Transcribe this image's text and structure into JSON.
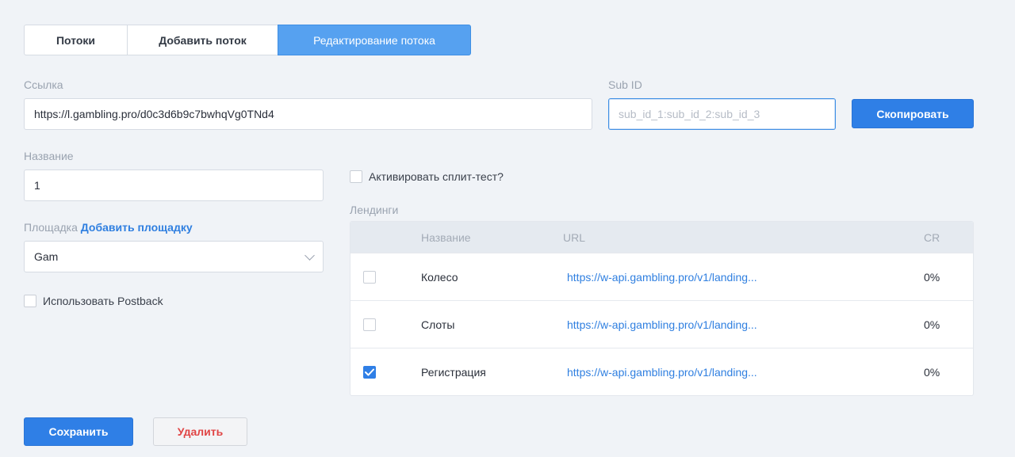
{
  "tabs": [
    {
      "label": "Потоки"
    },
    {
      "label": "Добавить поток"
    },
    {
      "label": "Редактирование потока",
      "active": true
    }
  ],
  "link": {
    "label": "Ссылка",
    "value": "https://l.gambling.pro/d0c3d6b9c7bwhqVg0TNd4"
  },
  "subid": {
    "label": "Sub ID",
    "placeholder": "sub_id_1:sub_id_2:sub_id_3",
    "value": ""
  },
  "copy_button": {
    "label": "Скопировать"
  },
  "name": {
    "label": "Название",
    "value": "1"
  },
  "platform": {
    "label": "Площадка",
    "add_link": "Добавить площадку",
    "selected": "Gam"
  },
  "postback": {
    "label": "Использовать Postback",
    "checked": false
  },
  "split_test": {
    "label": "Активировать сплит-тест?",
    "checked": false
  },
  "landings": {
    "label": "Лендинги",
    "columns": {
      "name": "Название",
      "url": "URL",
      "cr": "CR"
    },
    "rows": [
      {
        "name": "Колесо",
        "url": "https://w-api.gambling.pro/v1/landing...",
        "cr": "0%",
        "checked": false
      },
      {
        "name": "Слоты",
        "url": "https://w-api.gambling.pro/v1/landing...",
        "cr": "0%",
        "checked": false
      },
      {
        "name": "Регистрация",
        "url": "https://w-api.gambling.pro/v1/landing...",
        "cr": "0%",
        "checked": true
      }
    ]
  },
  "actions": {
    "save": "Сохранить",
    "delete": "Удалить"
  },
  "colors": {
    "accent": "#2f7fe6",
    "tab_active": "#56a1f0",
    "danger": "#e04545",
    "background": "#f0f3f7"
  },
  "icons": {
    "checkbox_checked": "check-icon",
    "select": "chevron-down-icon"
  }
}
